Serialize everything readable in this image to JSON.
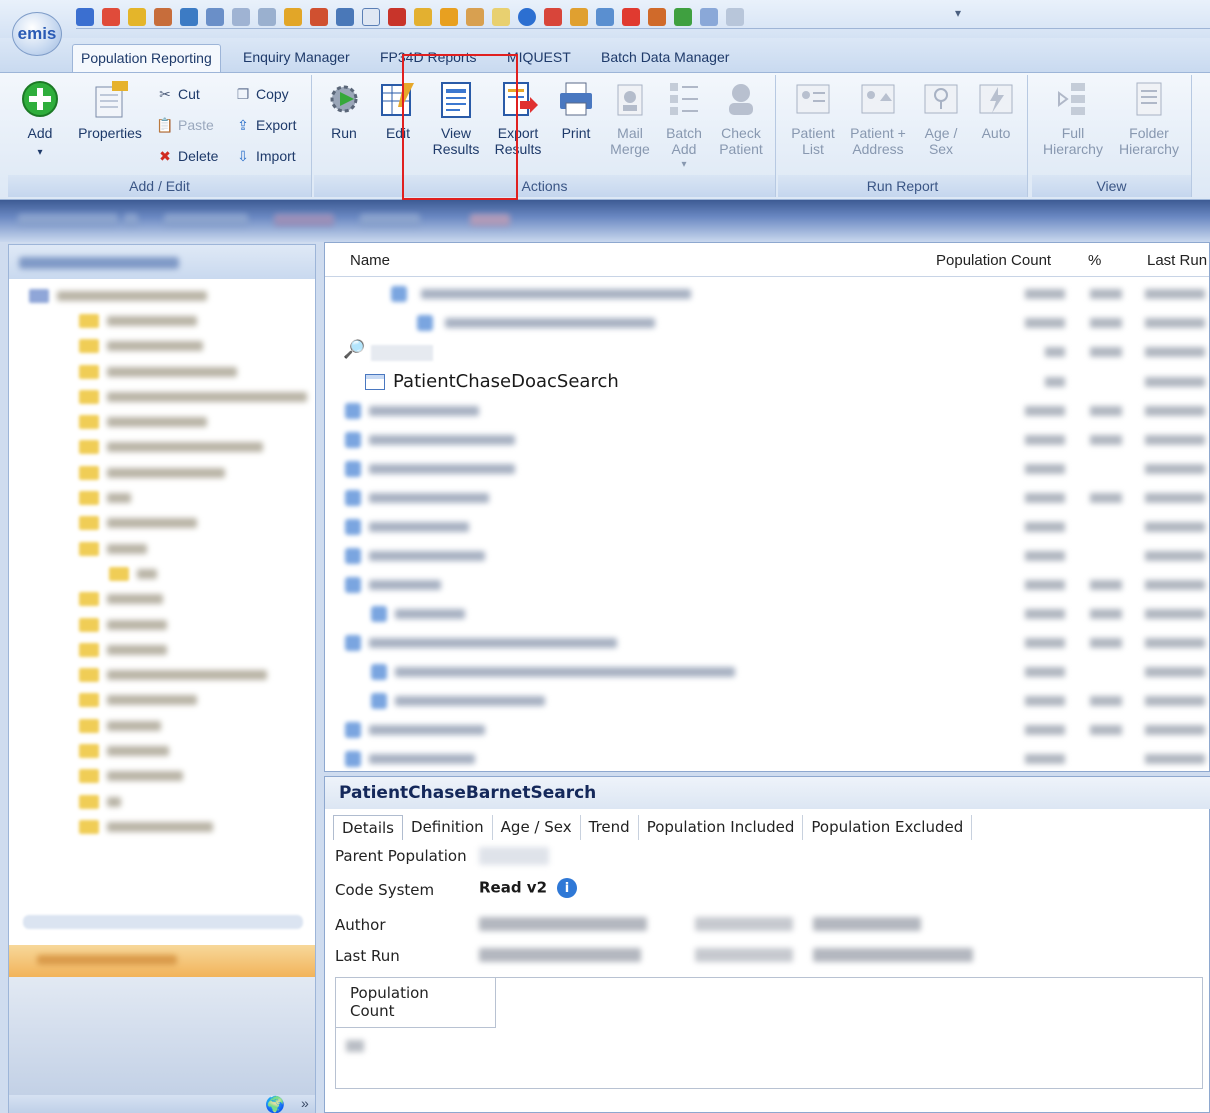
{
  "app": {
    "logo_text": "emis"
  },
  "tabs": [
    {
      "label": "Population Reporting",
      "active": true
    },
    {
      "label": "Enquiry Manager"
    },
    {
      "label": "FP34D Reports"
    },
    {
      "label": "MIQUEST"
    },
    {
      "label": "Batch Data Manager"
    }
  ],
  "ribbon": {
    "add_edit": {
      "label": "Add / Edit",
      "add": "Add",
      "properties": "Properties",
      "cut": "Cut",
      "paste": "Paste",
      "delete": "Delete",
      "copy": "Copy",
      "export": "Export",
      "import": "Import"
    },
    "actions": {
      "label": "Actions",
      "run": "Run",
      "edit": "Edit",
      "view_results_1": "View",
      "view_results_2": "Results",
      "export_results_1": "Export",
      "export_results_2": "Results",
      "print": "Print",
      "mail_merge_1": "Mail",
      "mail_merge_2": "Merge",
      "batch_add_1": "Batch",
      "batch_add_2": "Add",
      "check_patient_1": "Check",
      "check_patient_2": "Patient"
    },
    "run_report": {
      "label": "Run Report",
      "patient_list_1": "Patient",
      "patient_list_2": "List",
      "patient_address_1": "Patient +",
      "patient_address_2": "Address",
      "age_sex_1": "Age /",
      "age_sex_2": "Sex",
      "auto": "Auto"
    },
    "view": {
      "label": "View",
      "full_hierarchy_1": "Full",
      "full_hierarchy_2": "Hierarchy",
      "folder_hierarchy_1": "Folder",
      "folder_hierarchy_2": "Hierarchy"
    }
  },
  "list": {
    "columns": {
      "name": "Name",
      "population_count": "Population Count",
      "percent": "%",
      "last_run": "Last Run"
    },
    "highlight_item": "PatientChaseDoacSearch"
  },
  "details": {
    "title": "PatientChaseBarnetSearch",
    "tabs": [
      "Details",
      "Definition",
      "Age / Sex",
      "Trend",
      "Population Included",
      "Population Excluded"
    ],
    "parent_population_label": "Parent Population",
    "code_system_label": "Code System",
    "code_system_value": "Read v2",
    "author_label": "Author",
    "last_run_label": "Last Run",
    "population_count_label_1": "Population",
    "population_count_label_2": "Count"
  },
  "colors": {
    "highlight_box": "#e02020",
    "accent": "#2f78d6"
  }
}
